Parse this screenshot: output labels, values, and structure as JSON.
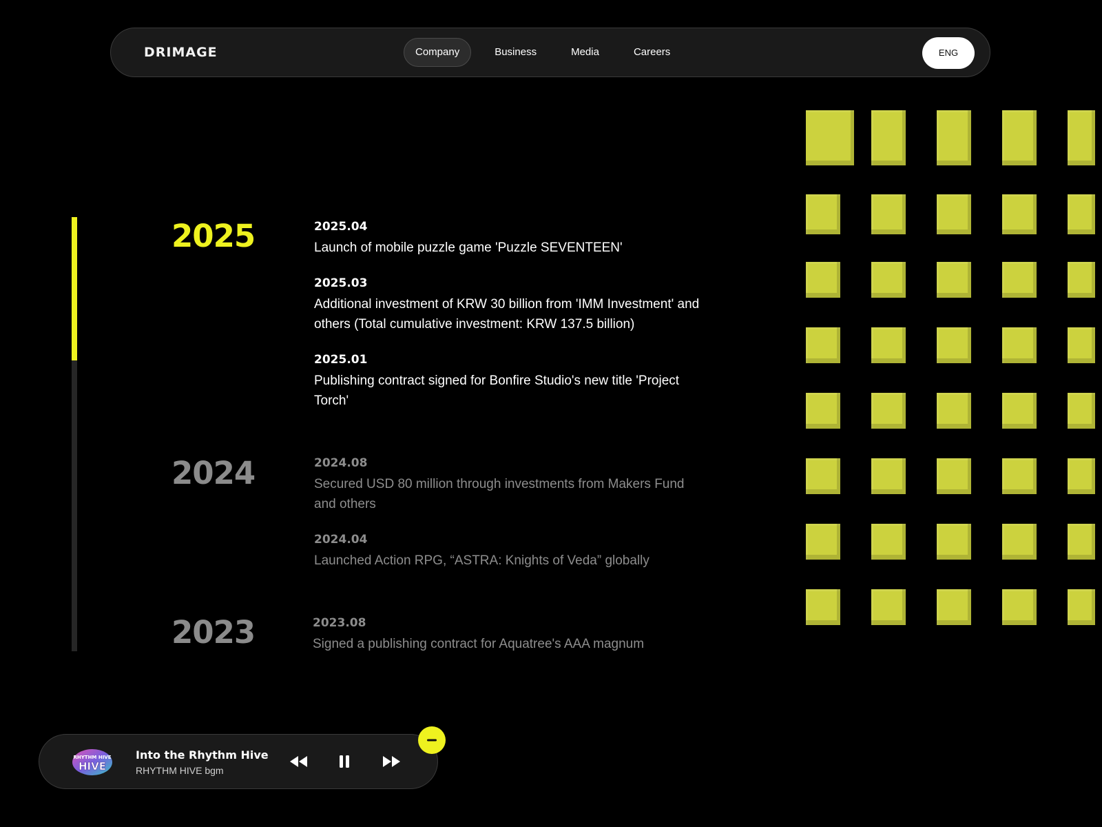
{
  "nav": {
    "logo": "DRIMAGE",
    "links": [
      {
        "label": "Company",
        "active": true
      },
      {
        "label": "Business",
        "active": false
      },
      {
        "label": "Media",
        "active": false
      },
      {
        "label": "Careers",
        "active": false
      }
    ],
    "lang_button": "ENG"
  },
  "timeline": {
    "progress_fraction": 0.33,
    "years": [
      {
        "year": "2025",
        "events": [
          {
            "date": "2025.04",
            "text": "Launch of mobile puzzle game 'Puzzle SEVENTEEN'"
          },
          {
            "date": "2025.03",
            "text": "Additional investment of KRW 30 billion from 'IMM Investment' and others (Total cumulative investment: KRW 137.5 billion)"
          },
          {
            "date": "2025.01",
            "text": "Publishing contract signed for Bonfire Studio's new title 'Project Torch'"
          }
        ]
      },
      {
        "year": "2024",
        "events": [
          {
            "date": "2024.08",
            "text": "Secured USD 80 million through investments from Makers Fund and others"
          },
          {
            "date": "2024.04",
            "text": "Launched Action RPG, “ASTRA: Knights of Veda” globally"
          }
        ]
      },
      {
        "year": "2023",
        "events": [
          {
            "date": "2023.08",
            "text": "Signed a publishing contract for Aquatree's AAA magnum"
          }
        ]
      }
    ]
  },
  "player": {
    "album_art_label": "RHYTHM HIVE",
    "track_title": "Into the Rhythm Hive",
    "track_subtitle": "RHYTHM HIVE bgm"
  },
  "colors": {
    "accent": "#eef21f",
    "cube": "#ccd23e",
    "background": "#000000",
    "muted_text": "#8d8d8d"
  },
  "icons": {
    "rewind": "rewind-icon",
    "pause": "pause-icon",
    "forward": "fast-forward-icon",
    "collapse": "minus-icon"
  }
}
